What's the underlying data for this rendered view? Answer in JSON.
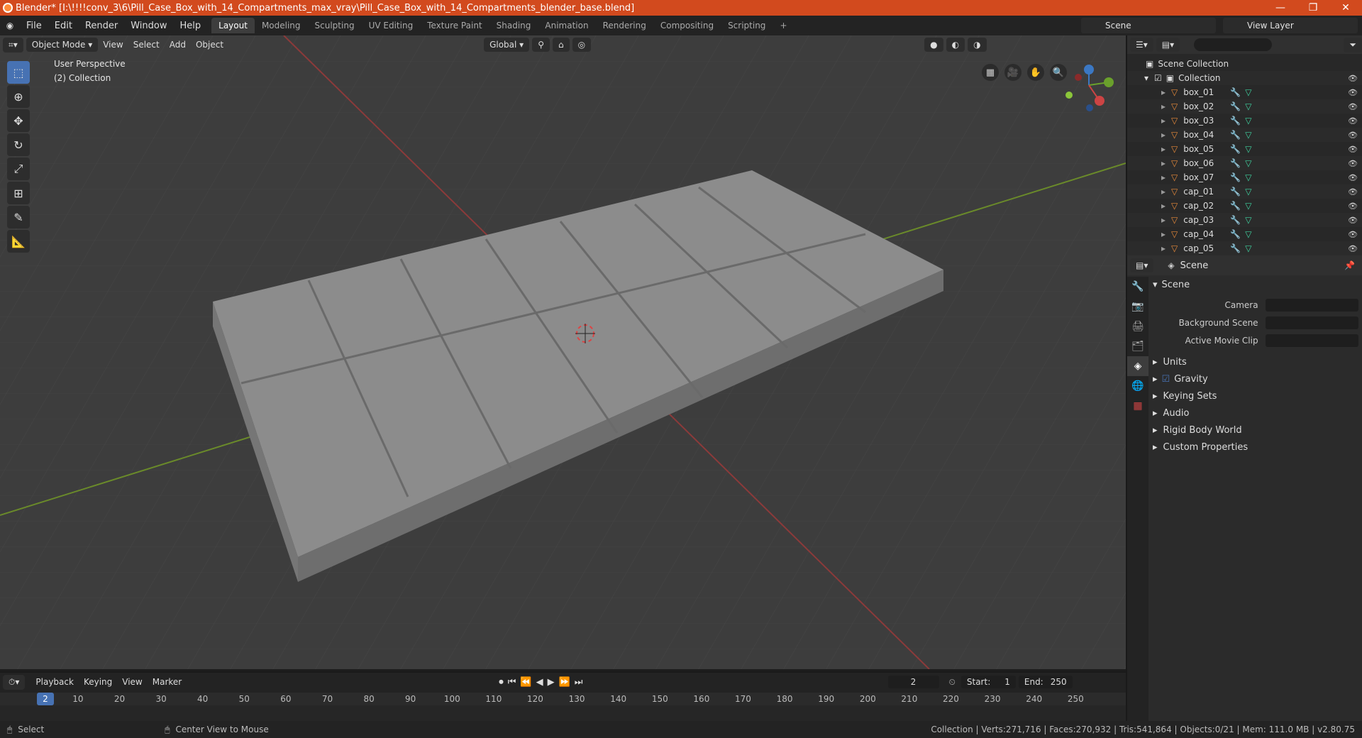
{
  "window": {
    "title": "Blender* [I:\\!!!!conv_3\\6\\Pill_Case_Box_with_14_Compartments_max_vray\\Pill_Case_Box_with_14_Compartments_blender_base.blend]",
    "min": "—",
    "max": "❐",
    "close": "✕"
  },
  "menu": [
    "File",
    "Edit",
    "Render",
    "Window",
    "Help"
  ],
  "workspaces": [
    "Layout",
    "Modeling",
    "Sculpting",
    "UV Editing",
    "Texture Paint",
    "Shading",
    "Animation",
    "Rendering",
    "Compositing",
    "Scripting"
  ],
  "scene_selector": "Scene",
  "view_layer": "View Layer",
  "viewport": {
    "mode": "Object Mode",
    "menus": [
      "View",
      "Select",
      "Add",
      "Object"
    ],
    "transform": "Global",
    "info_line1": "User Perspective",
    "info_line2": "(2) Collection"
  },
  "outliner": {
    "root": "Scene Collection",
    "collection": "Collection",
    "items": [
      "box_01",
      "box_02",
      "box_03",
      "box_04",
      "box_05",
      "box_06",
      "box_07",
      "cap_01",
      "cap_02",
      "cap_03",
      "cap_04",
      "cap_05"
    ]
  },
  "properties": {
    "context": "Scene",
    "panel_title": "Scene",
    "fields": [
      {
        "label": "Camera"
      },
      {
        "label": "Background Scene"
      },
      {
        "label": "Active Movie Clip"
      }
    ],
    "subpanels": [
      "Units",
      "Gravity",
      "Keying Sets",
      "Audio",
      "Rigid Body World",
      "Custom Properties"
    ]
  },
  "timeline": {
    "menus": [
      "Playback",
      "Keying",
      "View",
      "Marker"
    ],
    "current_frame": "2",
    "start_label": "Start:",
    "start": "1",
    "end_label": "End:",
    "end": "250",
    "ticks": [
      "2",
      "10",
      "20",
      "30",
      "40",
      "50",
      "60",
      "70",
      "80",
      "90",
      "100",
      "110",
      "120",
      "130",
      "140",
      "150",
      "160",
      "170",
      "180",
      "190",
      "200",
      "210",
      "220",
      "230",
      "240",
      "250"
    ]
  },
  "statusbar": {
    "left": "Select",
    "middle": "Center View to Mouse",
    "right": "Collection | Verts:271,716 | Faces:270,932 | Tris:541,864 | Objects:0/21 | Mem: 111.0 MB | v2.80.75"
  },
  "colors": {
    "titlebar": "#d24a1e",
    "accent": "#4772b3",
    "object_icon": "#e88a3a",
    "mesh_icon": "#3fd3a0"
  }
}
